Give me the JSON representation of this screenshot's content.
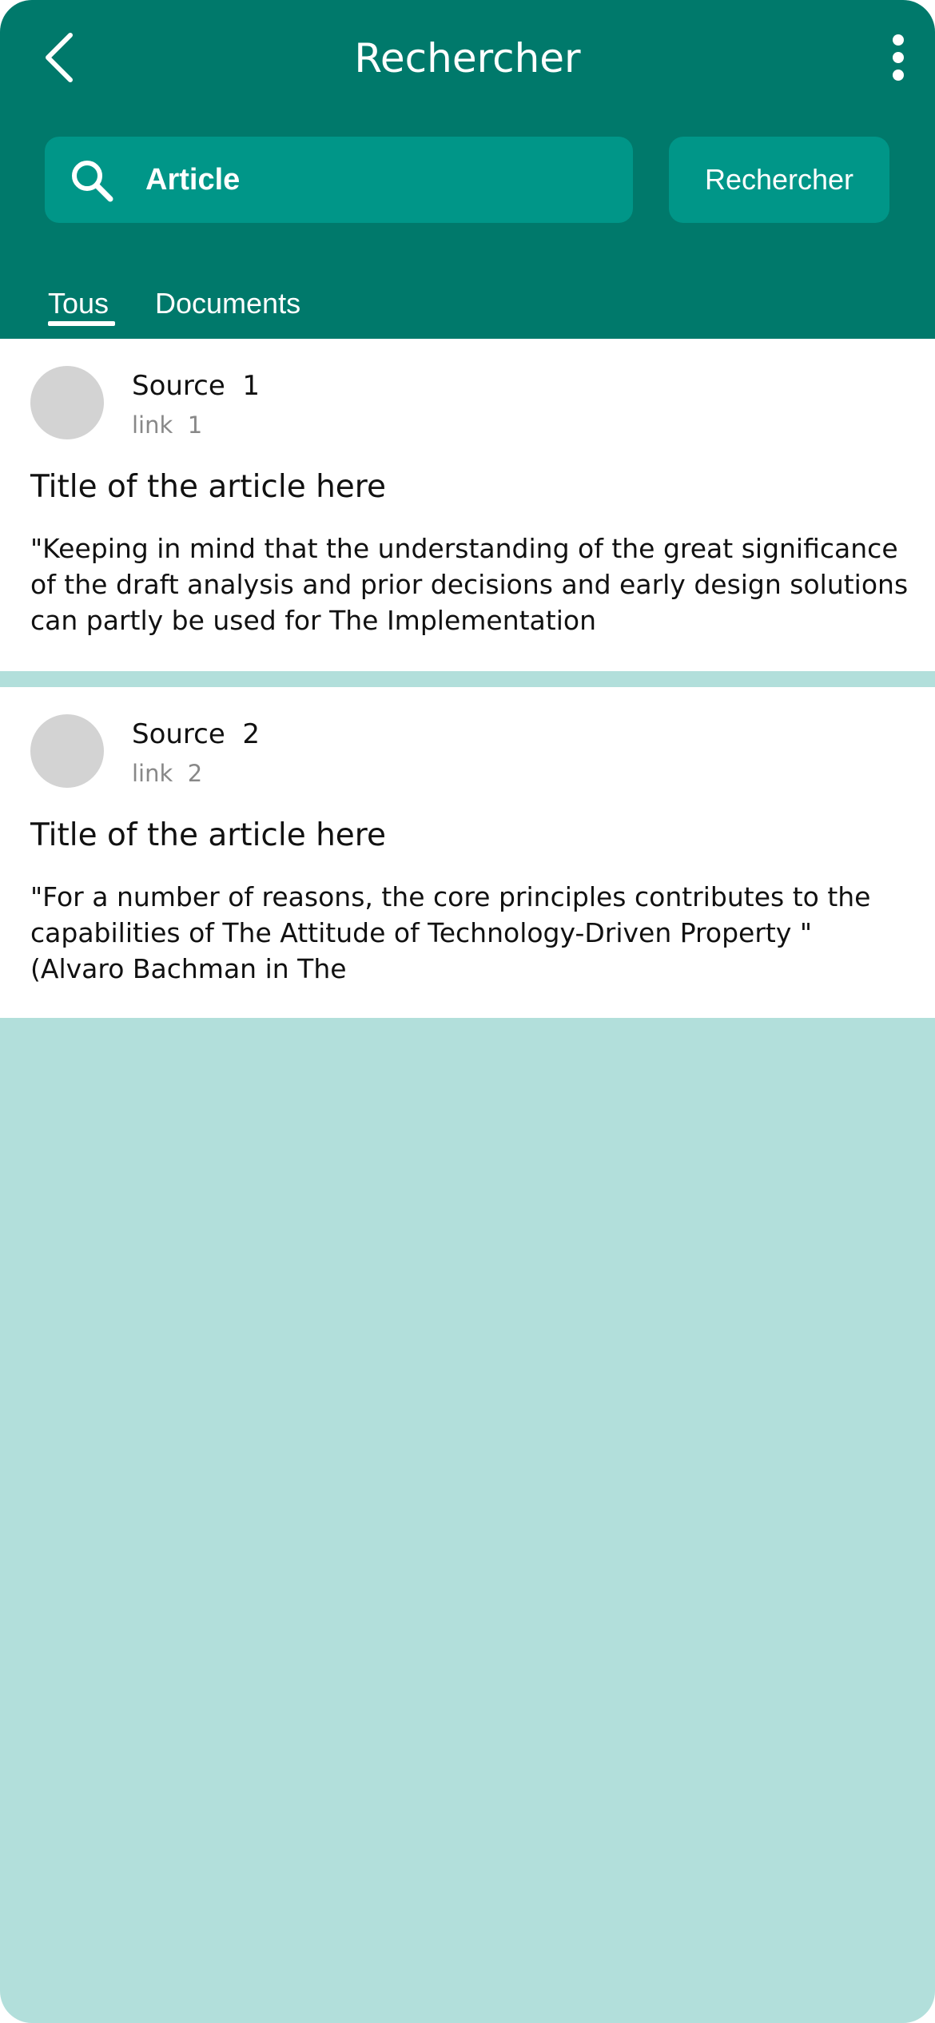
{
  "header": {
    "title": "Rechercher",
    "back_icon": "chevron-left-icon",
    "menu_icon": "more-vertical-icon",
    "background": "#00796b"
  },
  "search": {
    "value": "Article",
    "placeholder": "",
    "button_label": "Rechercher",
    "icon": "search-icon",
    "field_color": "#009688"
  },
  "tabs": [
    {
      "label": "Tous",
      "active": true
    },
    {
      "label": "Documents",
      "active": false
    }
  ],
  "results": [
    {
      "source": "Source  1",
      "link": "link  1",
      "title": "Title of the article here",
      "excerpt": "\"Keeping in mind that the understanding of the great significance of the draft analysis and prior decisions and early design solutions can partly be used for The Implementation"
    },
    {
      "source": "Source  2",
      "link": "link  2",
      "title": "Title of the article here",
      "excerpt": "\"For a number of reasons, the core principles contributes to the capabilities of The Attitude of Technology-Driven Property \" (Alvaro Bachman in The"
    }
  ],
  "colors": {
    "background": "#b2dfdb",
    "accent": "#009688",
    "header": "#00796b"
  }
}
